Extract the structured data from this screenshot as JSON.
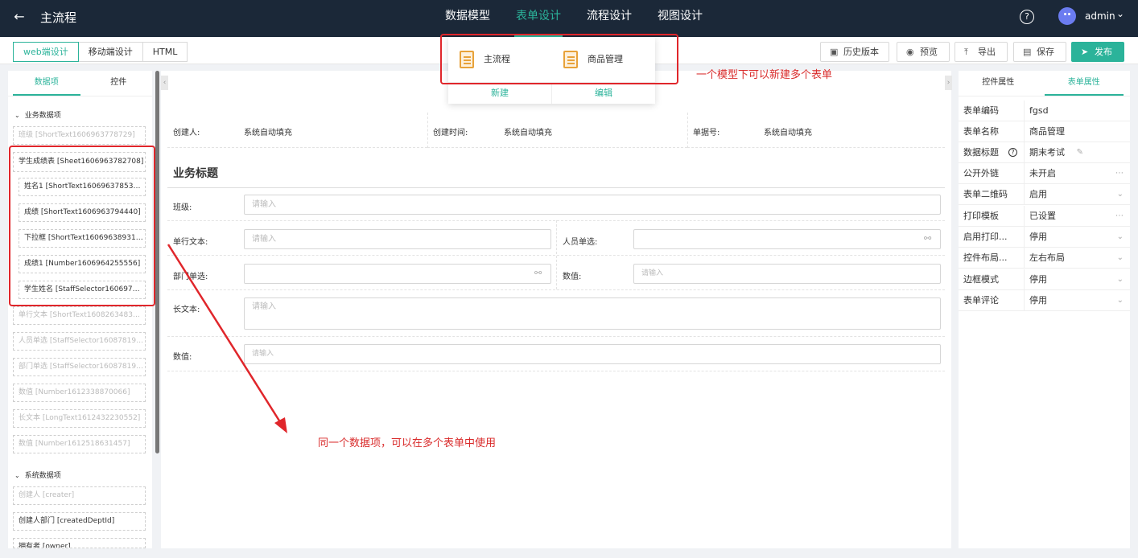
{
  "header": {
    "title": "主流程",
    "back_icon": "arrow-left-icon",
    "help_icon": "?",
    "user": "admin",
    "tabs": [
      {
        "label": "数据模型"
      },
      {
        "label": "表单设计"
      },
      {
        "label": "流程设计"
      },
      {
        "label": "视图设计"
      }
    ]
  },
  "toolbar": {
    "modes": [
      "web端设计",
      "移动端设计",
      "HTML"
    ],
    "buttons": [
      {
        "label": "历史版本",
        "icon": "history-icon"
      },
      {
        "label": "预览",
        "icon": "eye-icon"
      },
      {
        "label": "导出",
        "icon": "export-icon"
      },
      {
        "label": "保存",
        "icon": "save-icon"
      },
      {
        "label": "发布",
        "icon": "send-icon"
      }
    ]
  },
  "form_menu": {
    "items": [
      "主流程",
      "商品管理"
    ],
    "new_label": "新建",
    "edit_label": "编辑"
  },
  "left_panel": {
    "tabs": [
      "数据项",
      "控件"
    ],
    "biz_section": "业务数据项",
    "biz_fields": [
      "班级 [ShortText1606963778729]",
      "学生成绩表 [Sheet1606963782708]",
      "姓名1 [ShortText1606963785336]",
      "成绩 [ShortText1606963794440]",
      "下拉框 [ShortText16069638931…",
      "成绩1 [Number1606964255556]",
      "学生姓名 [StaffSelector160697…",
      "单行文本 [ShortText1608263483…",
      "人员单选 [StaffSelector16087819…",
      "部门单选 [StaffSelector16087819…",
      "数值 [Number1612338870066]",
      "长文本 [LongText1612432230552]",
      "数值 [Number1612518631457]"
    ],
    "sys_section": "系统数据项",
    "sys_fields": [
      "创建人 [creater]",
      "创建人部门 [createdDeptId]",
      "拥有者 [owner]"
    ]
  },
  "form": {
    "header_fields": [
      {
        "label": "创建人:",
        "value": "系统自动填充"
      },
      {
        "label": "创建时间:",
        "value": "系统自动填充"
      },
      {
        "label": "单据号:",
        "value": "系统自动填充"
      }
    ],
    "section_title": "业务标题",
    "placeholder": "请输入",
    "labels": {
      "class": "班级:",
      "short_text": "单行文本:",
      "staff": "人员单选:",
      "dept": "部门单选:",
      "number": "数值:",
      "long_text": "长文本:",
      "number2": "数值:"
    }
  },
  "right_panel": {
    "tabs": [
      "控件属性",
      "表单属性"
    ],
    "props": [
      {
        "k": "表单编码",
        "v": "fgsd"
      },
      {
        "k": "表单名称",
        "v": "商品管理"
      },
      {
        "k": "数据标题",
        "v": "期末考试"
      },
      {
        "k": "公开外链",
        "v": "未开启"
      },
      {
        "k": "表单二维码",
        "v": "启用"
      },
      {
        "k": "打印模板",
        "v": "已设置"
      },
      {
        "k": "启用打印...",
        "v": "停用"
      },
      {
        "k": "控件布局...",
        "v": "左右布局"
      },
      {
        "k": "边框模式",
        "v": "停用"
      },
      {
        "k": "表单评论",
        "v": "停用"
      }
    ]
  },
  "annotations": {
    "top": "一个模型下可以新建多个表单",
    "bottom": "同一个数据项，可以在多个表单中使用",
    "color": "#e0262b"
  },
  "colors": {
    "accent": "#2bb39a",
    "topbar": "#1b2838"
  }
}
